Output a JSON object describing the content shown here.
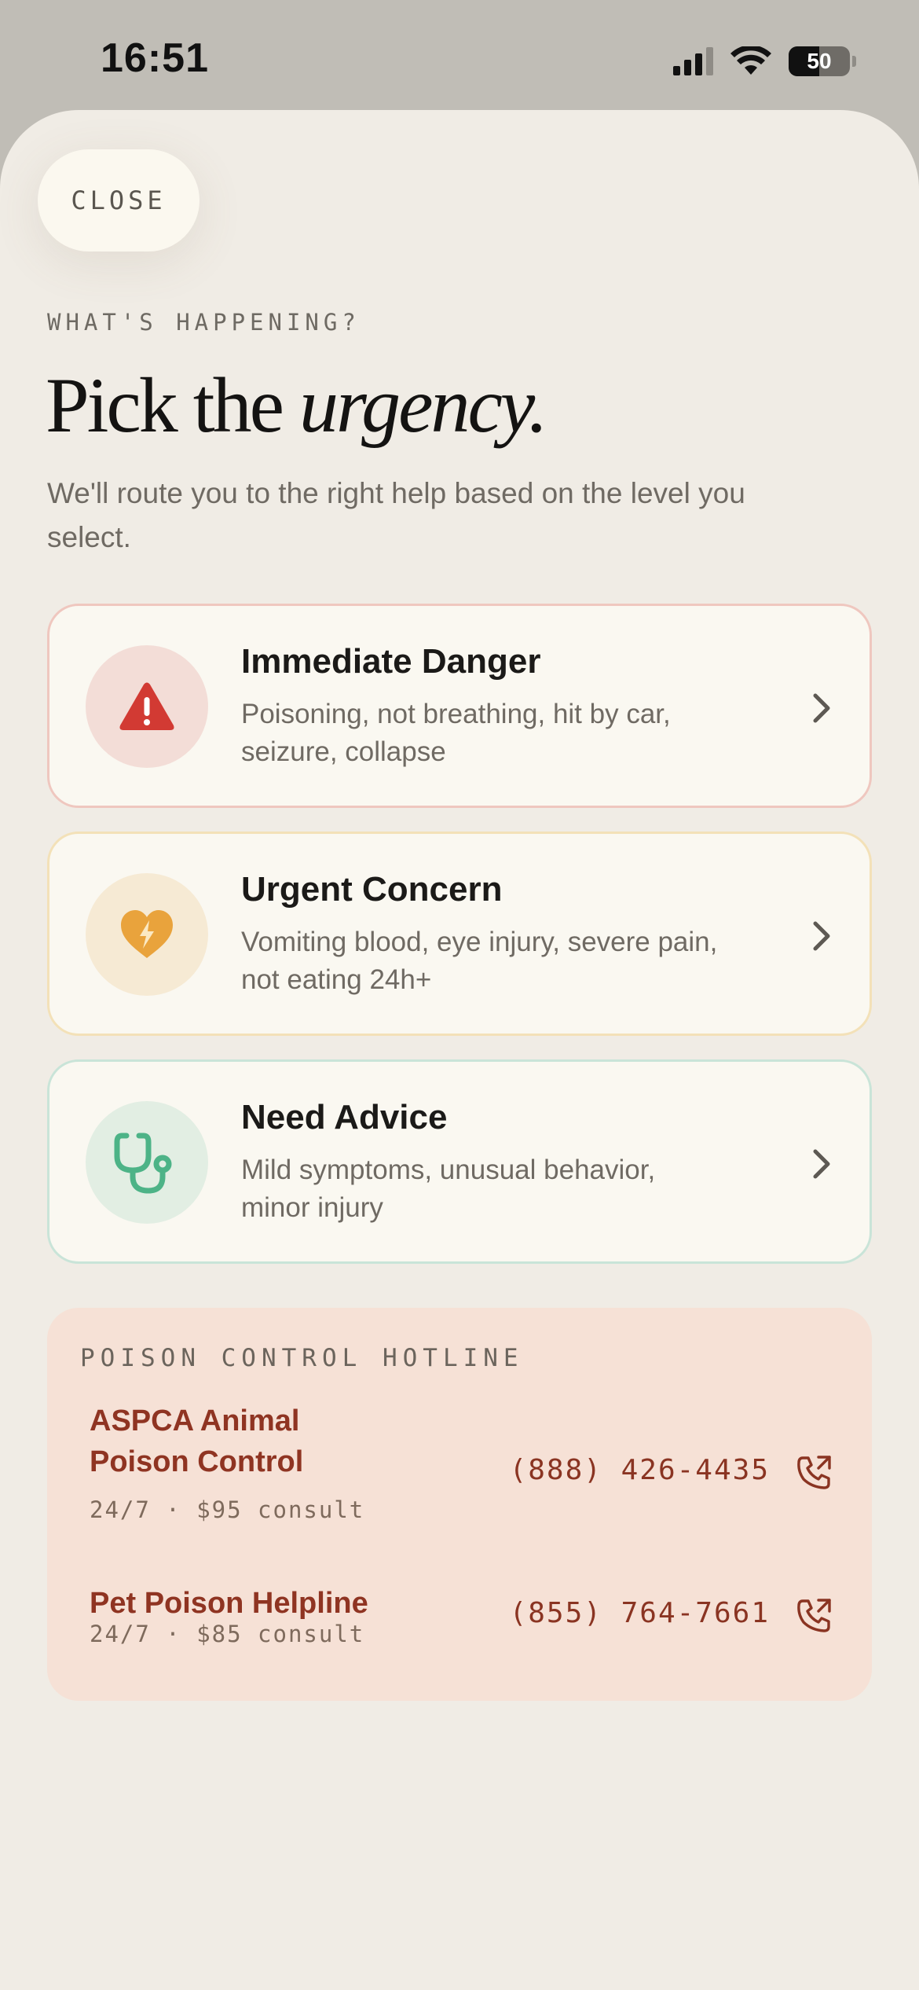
{
  "status_bar": {
    "time": "16:51",
    "battery": "50"
  },
  "close_label": "CLOSE",
  "eyebrow": "WHAT'S HAPPENING?",
  "headline": {
    "plain": "Pick the ",
    "italic": "urgency."
  },
  "subtext": "We'll route you to the right help based on the level you select.",
  "options": [
    {
      "title": "Immediate Danger",
      "description": "Poisoning, not breathing, hit by car, seizure, collapse",
      "icon": "warning-triangle-icon",
      "accent": "#d23a33",
      "circle_bg": "#f3ddd7",
      "border": "#efc7bf"
    },
    {
      "title": "Urgent Concern",
      "description": "Vomiting blood, eye injury, severe pain, not eating 24h+",
      "icon": "heart-bolt-icon",
      "accent": "#e9a33c",
      "circle_bg": "#f6ead4",
      "border": "#f3e1b8"
    },
    {
      "title": "Need Advice",
      "description": "Mild symptoms, unusual behavior, minor injury",
      "icon": "stethoscope-icon",
      "accent": "#4db387",
      "circle_bg": "#e2eee3",
      "border": "#c9e4d8"
    }
  ],
  "hotline": {
    "heading": "POISON CONTROL HOTLINE",
    "entries": [
      {
        "name_line1": "ASPCA Animal",
        "name_line2": "Poison Control",
        "meta": "24/7 · $95 consult",
        "phone": "(888) 426-4435"
      },
      {
        "name_line1": "Pet Poison Helpline",
        "meta": "24/7 · $85 consult",
        "phone": "(855) 764-7661"
      }
    ]
  }
}
